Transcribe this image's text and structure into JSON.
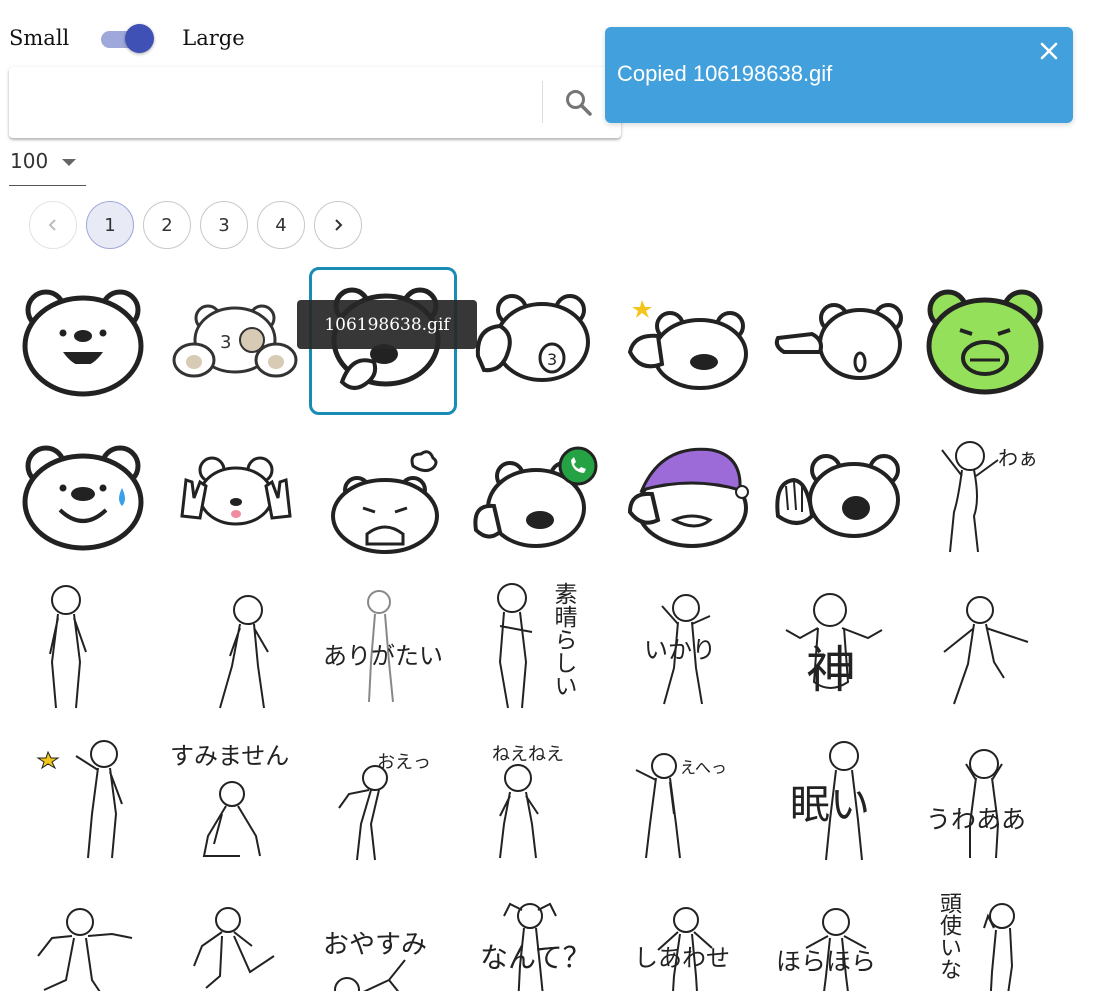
{
  "size_toggle": {
    "small_label": "Small",
    "large_label": "Large",
    "state": "large"
  },
  "search": {
    "value": "",
    "placeholder": ""
  },
  "per_page": {
    "value": "100"
  },
  "pagination": {
    "current": 1,
    "pages": [
      "1",
      "2",
      "3",
      "4"
    ]
  },
  "toast": {
    "message": "Copied 106198638.gif"
  },
  "tooltip": {
    "text": "106198638.gif"
  },
  "colors": {
    "accent": "#3f51b5",
    "toast_bg": "#42a0dc",
    "selection": "#1a8cb4",
    "green_bear": "#95e05a",
    "purple_hat": "#9c6bd8",
    "whatsapp_green": "#25a244"
  },
  "stickers": [
    {
      "row": 1,
      "items": [
        {
          "id": "bear-laugh",
          "text": ""
        },
        {
          "id": "bear-peek-paws",
          "text": ""
        },
        {
          "id": "106198638.gif",
          "text": "",
          "selected": true
        },
        {
          "id": "bear-hand-kiss",
          "text": ""
        },
        {
          "id": "bear-star-laugh",
          "text": ""
        },
        {
          "id": "bear-point-surprised",
          "text": ""
        },
        {
          "id": "bear-green-angry",
          "text": ""
        }
      ]
    },
    {
      "row": 2,
      "items": [
        {
          "id": "bear-sweat",
          "text": ""
        },
        {
          "id": "bear-peace",
          "text": ""
        },
        {
          "id": "bear-crying",
          "text": ""
        },
        {
          "id": "bear-phone-icon",
          "text": ""
        },
        {
          "id": "bear-sleep-hat",
          "text": ""
        },
        {
          "id": "bear-wave",
          "text": ""
        },
        {
          "id": "body-waa",
          "text": "わぁ"
        }
      ]
    },
    {
      "row": 3,
      "items": [
        {
          "id": "body-standing",
          "text": ""
        },
        {
          "id": "body-walking",
          "text": ""
        },
        {
          "id": "body-arigatai",
          "text": "ありがたい"
        },
        {
          "id": "body-subarashii",
          "text": "素晴らしい"
        },
        {
          "id": "body-ikari",
          "text": "いかり"
        },
        {
          "id": "body-kami",
          "text": "神"
        },
        {
          "id": "body-dance",
          "text": ""
        }
      ]
    },
    {
      "row": 4,
      "items": [
        {
          "id": "body-sparkle",
          "text": ""
        },
        {
          "id": "body-sumimasen",
          "text": "すみません"
        },
        {
          "id": "body-oe",
          "text": "おえっ"
        },
        {
          "id": "body-neenee",
          "text": "ねえねえ"
        },
        {
          "id": "body-ehe",
          "text": "えへっ"
        },
        {
          "id": "body-nemui",
          "text": "眠い"
        },
        {
          "id": "body-uwaa",
          "text": "うわああ"
        }
      ]
    },
    {
      "row": 5,
      "items": [
        {
          "id": "body-jump",
          "text": ""
        },
        {
          "id": "body-kick",
          "text": ""
        },
        {
          "id": "body-oyasumi",
          "text": "おやすみ"
        },
        {
          "id": "body-nante",
          "text": "なんて？"
        },
        {
          "id": "body-shiawase",
          "text": "しあわせ"
        },
        {
          "id": "body-horahora",
          "text": "ほらほら"
        },
        {
          "id": "body-zutsuu",
          "text": "頭使いな"
        }
      ]
    }
  ]
}
